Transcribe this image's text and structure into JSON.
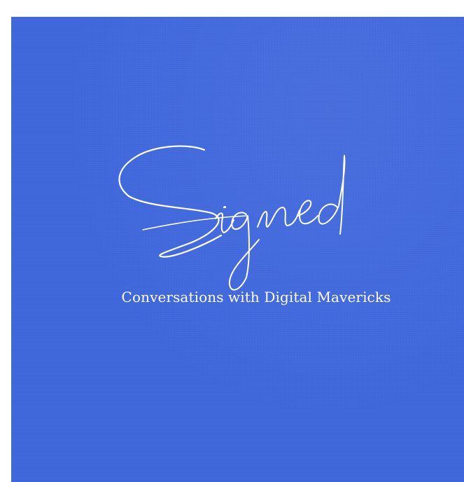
{
  "cover": {
    "background_color": "#3f67dc",
    "logo": {
      "text": "Signed",
      "color": "#ffffff"
    },
    "subtitle": "Conversations with Digital Mavericks"
  }
}
